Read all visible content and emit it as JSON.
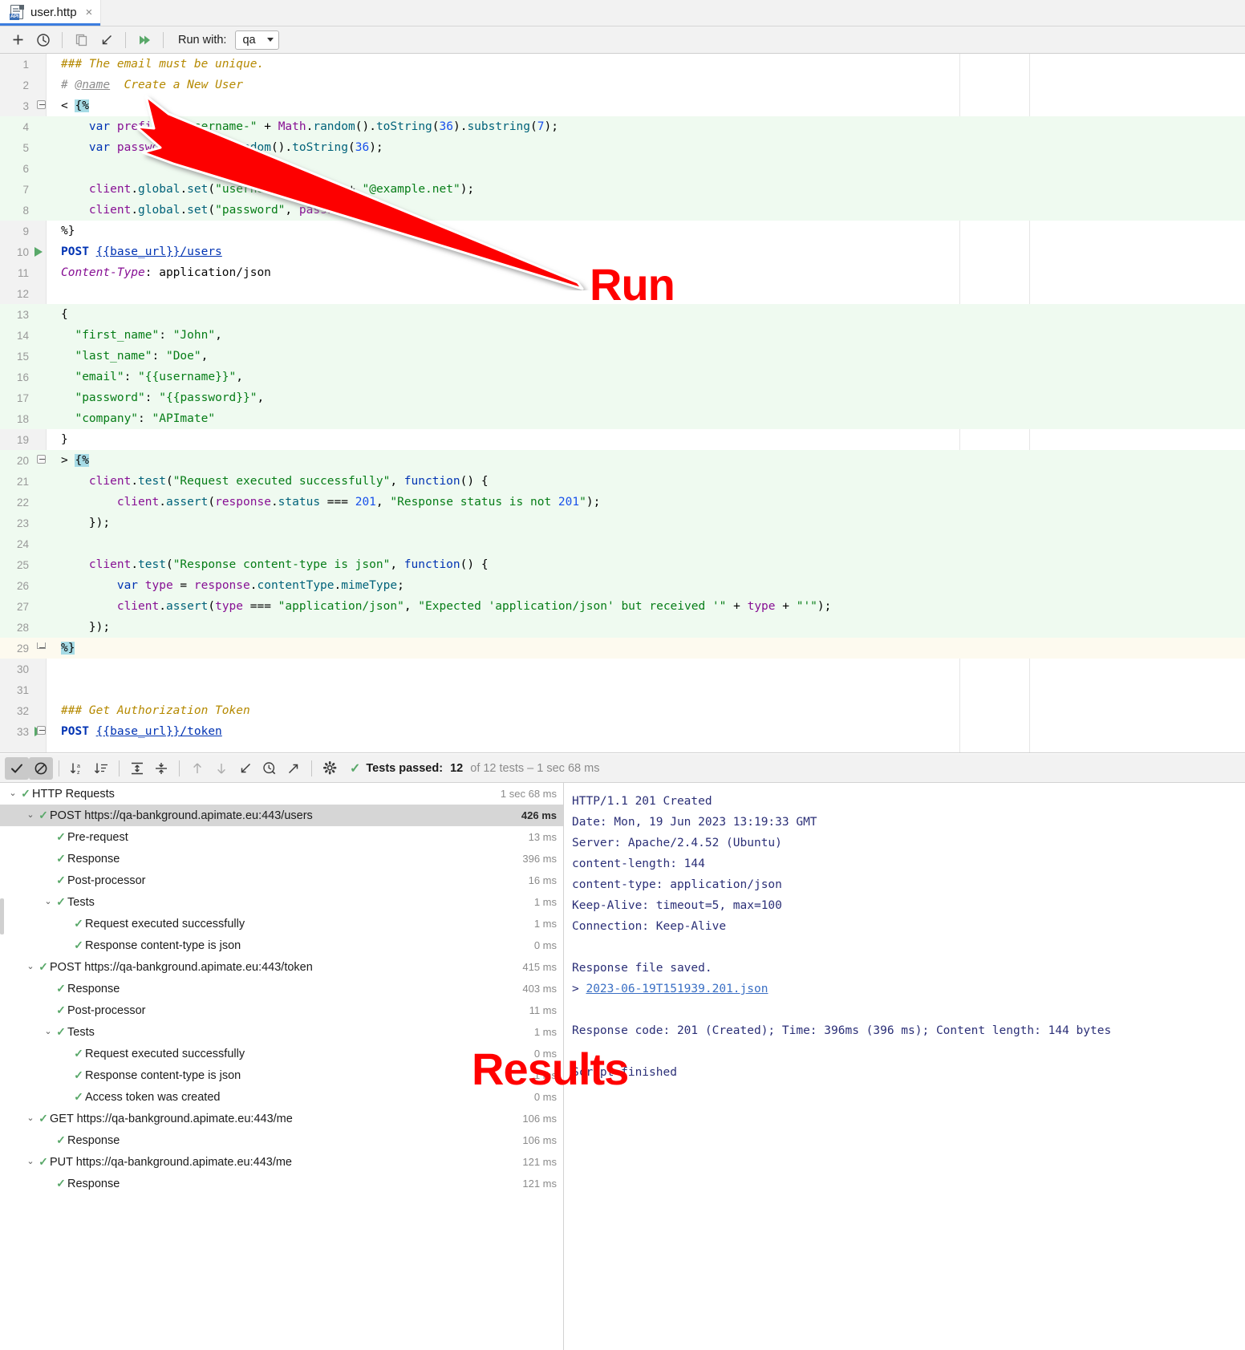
{
  "window": {
    "tab": {
      "title": "user.http",
      "icon": "api-file-icon",
      "close": "×"
    }
  },
  "toolbar": {
    "add_label": "+",
    "history_icon": "clock-icon",
    "copy_icon": "copy-icon",
    "import_icon": "import-arrow-icon",
    "run_all_icon": "run-all-icon",
    "run_with_label": "Run with:",
    "environment": "qa"
  },
  "editor": {
    "lines": [
      {
        "n": "1",
        "bg": "",
        "text": "### The email must be unique."
      },
      {
        "n": "2",
        "bg": "",
        "text": "# @name Create a New User"
      },
      {
        "n": "3",
        "bg": "",
        "text": "< {%"
      },
      {
        "n": "4",
        "bg": "green",
        "text": "    var prefix = \"username-\" + Math.random().toString(36).substring(7);"
      },
      {
        "n": "5",
        "bg": "green",
        "text": "    var password = Math.random().toString(36);"
      },
      {
        "n": "6",
        "bg": "green",
        "text": ""
      },
      {
        "n": "7",
        "bg": "green",
        "text": "    client.global.set(\"username\", prefix + \"@example.net\");"
      },
      {
        "n": "8",
        "bg": "green",
        "text": "    client.global.set(\"password\", password);"
      },
      {
        "n": "9",
        "bg": "",
        "text": "%}"
      },
      {
        "n": "10",
        "bg": "",
        "text": "POST {{base_url}}/users",
        "run": true
      },
      {
        "n": "11",
        "bg": "",
        "text": "Content-Type: application/json"
      },
      {
        "n": "12",
        "bg": "",
        "text": ""
      },
      {
        "n": "13",
        "bg": "green",
        "text": "{"
      },
      {
        "n": "14",
        "bg": "green",
        "text": "  \"first_name\": \"John\","
      },
      {
        "n": "15",
        "bg": "green",
        "text": "  \"last_name\": \"Doe\","
      },
      {
        "n": "16",
        "bg": "green",
        "text": "  \"email\": \"{{username}}\","
      },
      {
        "n": "17",
        "bg": "green",
        "text": "  \"password\": \"{{password}}\","
      },
      {
        "n": "18",
        "bg": "green",
        "text": "  \"company\": \"APImate\""
      },
      {
        "n": "19",
        "bg": "",
        "text": "}"
      },
      {
        "n": "20",
        "bg": "green",
        "text": "> {%"
      },
      {
        "n": "21",
        "bg": "green",
        "text": "    client.test(\"Request executed successfully\", function() {"
      },
      {
        "n": "22",
        "bg": "green",
        "text": "        client.assert(response.status === 201, \"Response status is not 201\");"
      },
      {
        "n": "23",
        "bg": "green",
        "text": "    });"
      },
      {
        "n": "24",
        "bg": "green",
        "text": ""
      },
      {
        "n": "25",
        "bg": "green",
        "text": "    client.test(\"Response content-type is json\", function() {"
      },
      {
        "n": "26",
        "bg": "green",
        "text": "        var type = response.contentType.mimeType;"
      },
      {
        "n": "27",
        "bg": "green",
        "text": "        client.assert(type === \"application/json\", \"Expected 'application/json' but received '\" + type + \"'\");"
      },
      {
        "n": "28",
        "bg": "green",
        "text": "    });"
      },
      {
        "n": "29",
        "bg": "yellow",
        "text": "%}"
      },
      {
        "n": "30",
        "bg": "",
        "text": ""
      },
      {
        "n": "31",
        "bg": "",
        "text": ""
      },
      {
        "n": "32",
        "bg": "",
        "text": "### Get Authorization Token"
      },
      {
        "n": "33",
        "bg": "",
        "text": "POST {{base_url}}/token",
        "run": true
      }
    ]
  },
  "annotations": {
    "run": "Run",
    "results": "Results",
    "color": "#ff0000"
  },
  "results_toolbar": {
    "buttons": [
      {
        "name": "show-passed-toggle",
        "icon": "check-icon",
        "state": "active"
      },
      {
        "name": "hide-ignored-toggle",
        "icon": "no-entry-icon",
        "state": "active"
      },
      {
        "name": "sort-alphabetically-button",
        "icon": "sort-alpha-icon",
        "state": "normal"
      },
      {
        "name": "sort-by-duration-button",
        "icon": "sort-duration-icon",
        "state": "normal"
      },
      {
        "name": "expand-all-button",
        "icon": "expand-all-icon",
        "state": "normal"
      },
      {
        "name": "collapse-all-button",
        "icon": "collapse-all-icon",
        "state": "normal"
      },
      {
        "name": "previous-failed-button",
        "icon": "arrow-up-icon",
        "state": "disabled"
      },
      {
        "name": "next-failed-button",
        "icon": "arrow-down-icon",
        "state": "disabled"
      },
      {
        "name": "import-results-button",
        "icon": "import-arrow-icon",
        "state": "normal"
      },
      {
        "name": "test-history-button",
        "icon": "clock-search-icon",
        "state": "normal"
      },
      {
        "name": "export-results-button",
        "icon": "export-arrow-icon",
        "state": "normal"
      },
      {
        "name": "settings-button",
        "icon": "gear-icon",
        "state": "normal"
      }
    ],
    "status": {
      "prefix": "Tests passed:",
      "passed": "12",
      "suffix": "of 12 tests – 1 sec 68 ms"
    }
  },
  "tree": {
    "rows": [
      {
        "indent": 0,
        "chev": "⌄",
        "label": "HTTP Requests",
        "time": "1 sec 68 ms",
        "selected": false
      },
      {
        "indent": 1,
        "chev": "⌄",
        "label": "POST https://qa-bankground.apimate.eu:443/users",
        "time": "426 ms",
        "selected": true
      },
      {
        "indent": 2,
        "chev": "",
        "label": "Pre-request",
        "time": "13 ms",
        "selected": false
      },
      {
        "indent": 2,
        "chev": "",
        "label": "Response",
        "time": "396 ms",
        "selected": false
      },
      {
        "indent": 2,
        "chev": "",
        "label": "Post-processor",
        "time": "16 ms",
        "selected": false
      },
      {
        "indent": 2,
        "chev": "⌄",
        "label": "Tests",
        "time": "1 ms",
        "selected": false
      },
      {
        "indent": 3,
        "chev": "",
        "label": "Request executed successfully",
        "time": "1 ms",
        "selected": false
      },
      {
        "indent": 3,
        "chev": "",
        "label": "Response content-type is json",
        "time": "0 ms",
        "selected": false
      },
      {
        "indent": 1,
        "chev": "⌄",
        "label": "POST https://qa-bankground.apimate.eu:443/token",
        "time": "415 ms",
        "selected": false
      },
      {
        "indent": 2,
        "chev": "",
        "label": "Response",
        "time": "403 ms",
        "selected": false
      },
      {
        "indent": 2,
        "chev": "",
        "label": "Post-processor",
        "time": "11 ms",
        "selected": false
      },
      {
        "indent": 2,
        "chev": "⌄",
        "label": "Tests",
        "time": "1 ms",
        "selected": false
      },
      {
        "indent": 3,
        "chev": "",
        "label": "Request executed successfully",
        "time": "0 ms",
        "selected": false
      },
      {
        "indent": 3,
        "chev": "",
        "label": "Response content-type is json",
        "time": "1 ms",
        "selected": false
      },
      {
        "indent": 3,
        "chev": "",
        "label": "Access token was created",
        "time": "0 ms",
        "selected": false
      },
      {
        "indent": 1,
        "chev": "⌄",
        "label": "GET https://qa-bankground.apimate.eu:443/me",
        "time": "106 ms",
        "selected": false
      },
      {
        "indent": 2,
        "chev": "",
        "label": "Response",
        "time": "106 ms",
        "selected": false
      },
      {
        "indent": 1,
        "chev": "⌄",
        "label": "PUT https://qa-bankground.apimate.eu:443/me",
        "time": "121 ms",
        "selected": false
      },
      {
        "indent": 2,
        "chev": "",
        "label": "Response",
        "time": "121 ms",
        "selected": false
      }
    ]
  },
  "console": {
    "lines": [
      {
        "text": "HTTP/1.1 201 Created",
        "type": "plain"
      },
      {
        "text": "Date: Mon, 19 Jun 2023 13:19:33 GMT",
        "type": "plain"
      },
      {
        "text": "Server: Apache/2.4.52 (Ubuntu)",
        "type": "plain"
      },
      {
        "text": "content-length: 144",
        "type": "plain"
      },
      {
        "text": "content-type: application/json",
        "type": "plain"
      },
      {
        "text": "Keep-Alive: timeout=5, max=100",
        "type": "plain"
      },
      {
        "text": "Connection: Keep-Alive",
        "type": "plain"
      },
      {
        "text": "",
        "type": "plain"
      },
      {
        "text": "Response file saved.",
        "type": "plain"
      },
      {
        "text": "2023-06-19T151939.201.json",
        "type": "link",
        "prefix": "> "
      },
      {
        "text": "",
        "type": "plain"
      },
      {
        "text": "Response code: 201 (Created); Time: 396ms (396 ms); Content length: 144 bytes",
        "type": "plain"
      },
      {
        "text": "",
        "type": "plain"
      },
      {
        "text": "Script finished",
        "type": "plain"
      }
    ]
  }
}
